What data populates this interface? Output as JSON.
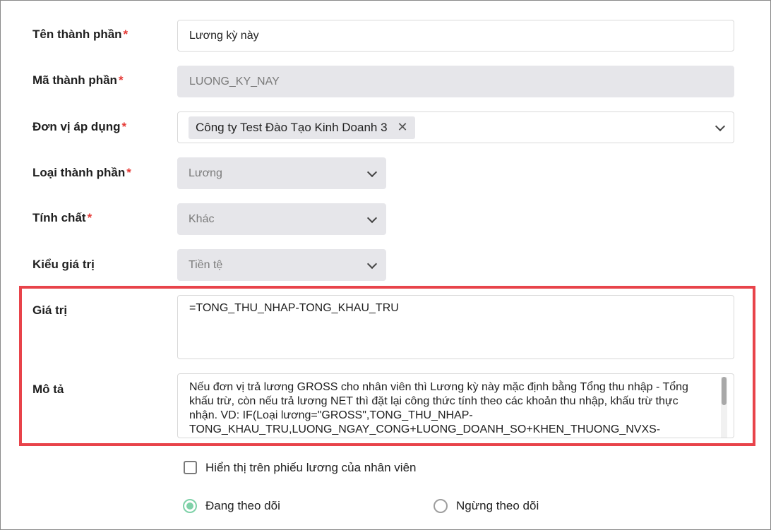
{
  "fields": {
    "ten_thanh_phan": {
      "label": "Tên thành phần",
      "value": "Lương kỳ này",
      "required": "*"
    },
    "ma_thanh_phan": {
      "label": "Mã thành phần",
      "value": "LUONG_KY_NAY",
      "required": "*"
    },
    "don_vi_ap_dung": {
      "label": "Đơn vị áp dụng",
      "chip": "Công ty Test Đào Tạo Kinh Doanh 3",
      "required": "*"
    },
    "loai_thanh_phan": {
      "label": "Loại thành phần",
      "value": "Lương",
      "required": "*"
    },
    "tinh_chat": {
      "label": "Tính chất",
      "value": "Khác",
      "required": "*"
    },
    "kieu_gia_tri": {
      "label": "Kiểu giá trị",
      "value": "Tiền tệ"
    },
    "gia_tri": {
      "label": "Giá trị",
      "value": "=TONG_THU_NHAP-TONG_KHAU_TRU"
    },
    "mo_ta": {
      "label": "Mô tả",
      "lines": [
        "Nếu đơn vị trả lương GROSS cho nhân viên thì Lương kỳ này mặc định bằng Tổng thu nhập - Tổng",
        "khấu trừ, còn nếu trả lương NET thì đặt lại công thức tính theo các khoản thu nhập, khấu trừ thực",
        "nhận. VD: IF(Loại lương=\"GROSS\",TONG_THU_NHAP-",
        "TONG_KHAU_TRU,LUONG_NGAY_CONG+LUONG_DOANH_SO+KHEN_THUONG_NVXS-"
      ]
    }
  },
  "options": {
    "show_on_payslip": "Hiển thị trên phiếu lương của nhân viên",
    "status_active": "Đang theo dõi",
    "status_inactive": "Ngừng theo dõi"
  },
  "colors": {
    "required": "#e53935",
    "highlight_border": "#e8434a",
    "radio_selected": "#7fd1a8"
  }
}
